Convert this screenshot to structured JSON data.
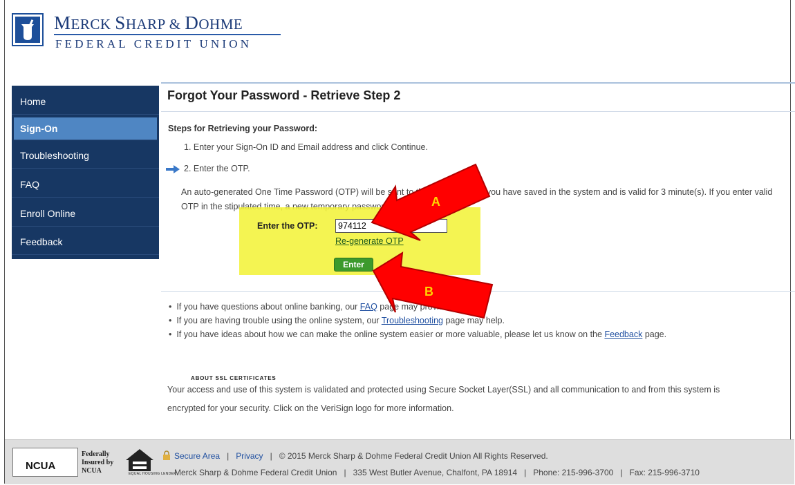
{
  "header": {
    "brand_line1_cap1": "M",
    "brand_line1_rest1": "ERCK ",
    "brand_line1_cap2": "S",
    "brand_line1_rest2": "HARP & ",
    "brand_line1_cap3": "D",
    "brand_line1_rest3": "OHME",
    "brand_line2": "FEDERAL CREDIT UNION"
  },
  "sidebar": {
    "items": [
      {
        "label": "Home"
      },
      {
        "label": "Sign-On"
      },
      {
        "label": "Troubleshooting"
      },
      {
        "label": "FAQ"
      },
      {
        "label": "Enroll Online"
      },
      {
        "label": "Feedback"
      }
    ]
  },
  "main": {
    "title": "Forgot Your Password - Retrieve Step 2",
    "steps_heading": "Steps for Retrieving your Password:",
    "step1": "1.   Enter your Sign-On ID and Email address and click Continue.",
    "step2": "2.   Enter the OTP.",
    "otp_paragraph": "An auto-generated One Time Password (OTP) will be sent to the email address you have saved in the system and is valid for 3 minute(s). If you enter valid OTP in the stipulated time, a new temporary password will be emailed.",
    "otp_label": "Enter the OTP:",
    "otp_value": "974112",
    "regenerate_link": "Re-generate OTP",
    "enter_button": "Enter",
    "bullet1_pre": "If you have questions about online banking, our ",
    "bullet1_link": "FAQ",
    "bullet1_post": " page may provide answers.",
    "bullet2_pre": "If you are having trouble using the online system, our ",
    "bullet2_link": "Troubleshooting",
    "bullet2_post": " page may help.",
    "bullet3_pre": "If you have ideas about how we can make the online system easier or more valuable, please let us know on the ",
    "bullet3_link": "Feedback",
    "bullet3_post": " page.",
    "ssl_title": "ABOUT SSL CERTIFICATES",
    "ssl_text1": "Your access and use of this system is validated and protected using Secure Socket Layer(SSL) and all communication to and from this system is",
    "ssl_text2": "encrypted for your security. Click on the VeriSign logo for more information."
  },
  "annotations": {
    "label_a": "A",
    "label_b": "B"
  },
  "footer": {
    "ncua": "NCUA",
    "federally": "Federally",
    "insured_by": "Insured by",
    "ncua_small": "NCUA",
    "equal_housing": "EQUAL HOUSING LENDER",
    "secure_area": "Secure Area",
    "privacy": "Privacy",
    "sep": "|",
    "copyright": "© 2015 Merck Sharp & Dohme Federal Credit Union All Rights Reserved.",
    "org_name": "Merck Sharp & Dohme Federal Credit Union",
    "address": "335 West Butler Avenue, Chalfont, PA 18914",
    "phone": "Phone: 215-996-3700",
    "fax": "Fax: 215-996-3710"
  },
  "colors": {
    "sidebar_bg": "#173763",
    "sidebar_active": "#4f86c3",
    "highlight": "#f2f23a",
    "button_green": "#3c9a2c",
    "arrow_red": "#ff0000",
    "link_blue": "#1f4fa0"
  }
}
